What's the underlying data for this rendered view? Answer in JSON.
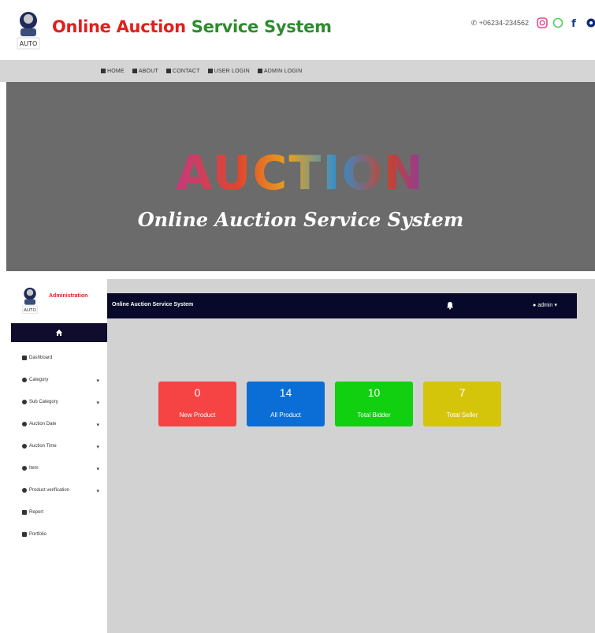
{
  "site": {
    "title_part1": "Online Auction",
    "title_part2": "Service System",
    "phone": "+06234-234562",
    "logo_text": "AUTO",
    "social_icons": [
      "instagram-icon",
      "whatsapp-icon",
      "facebook-icon",
      "circle-icon"
    ]
  },
  "nav": {
    "items": [
      {
        "label": "HOME",
        "icon": "home-icon"
      },
      {
        "label": "ABOUT",
        "icon": "info-icon"
      },
      {
        "label": "CONTACT",
        "icon": "phone-icon"
      },
      {
        "label": "USER LOGIN",
        "icon": "user-icon"
      },
      {
        "label": "ADMIN LOGIN",
        "icon": "user-icon"
      }
    ]
  },
  "hero": {
    "word": "AUCTION",
    "subtitle": "Online Auction Service System"
  },
  "admin": {
    "sidebar_label": "Administration",
    "menu": [
      {
        "label": "Dashboard",
        "caret": false
      },
      {
        "label": "Category",
        "caret": true
      },
      {
        "label": "Sub Category",
        "caret": true
      },
      {
        "label": "Auction Date",
        "caret": true
      },
      {
        "label": "Auction Time",
        "caret": true
      },
      {
        "label": "Item",
        "caret": true
      },
      {
        "label": "Product verification",
        "caret": true
      },
      {
        "label": "Report",
        "caret": false
      },
      {
        "label": "Portfolio",
        "caret": false
      }
    ],
    "topbar_title": "Online Auction Service System",
    "user_label": "admin",
    "cards": [
      {
        "value": "0",
        "label": "New Product",
        "color": "#f64343"
      },
      {
        "value": "14",
        "label": "All Product",
        "color": "#0b6ed6"
      },
      {
        "value": "10",
        "label": "Total Bidder",
        "color": "#10d00f"
      },
      {
        "value": "7",
        "label": "Total Seller",
        "color": "#d5c50a"
      }
    ]
  }
}
